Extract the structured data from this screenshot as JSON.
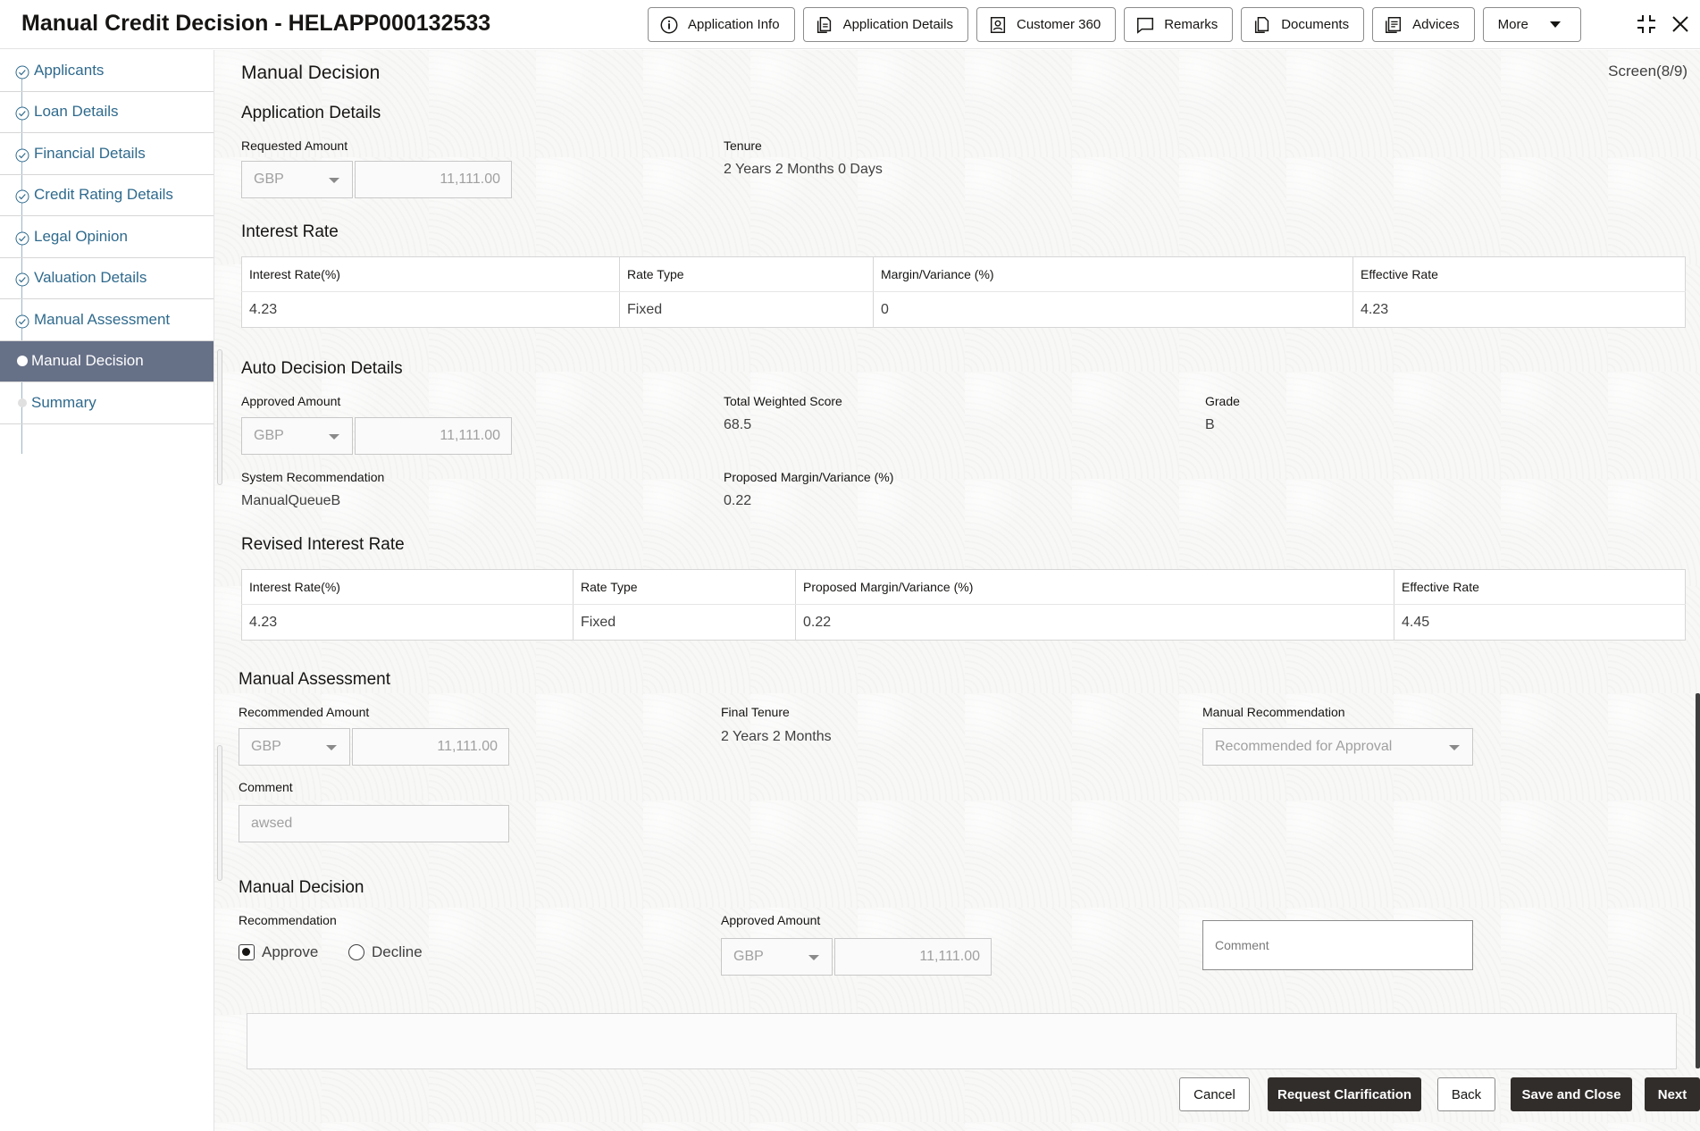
{
  "header": {
    "title": "Manual Credit Decision - HELAPP000132533",
    "buttons": {
      "app_info": "Application Info",
      "app_details": "Application Details",
      "customer360": "Customer 360",
      "remarks": "Remarks",
      "documents": "Documents",
      "advices": "Advices",
      "more": "More"
    }
  },
  "sidebar": {
    "items": [
      {
        "label": "Applicants",
        "status": "done"
      },
      {
        "label": "Loan Details",
        "status": "done"
      },
      {
        "label": "Financial Details",
        "status": "done"
      },
      {
        "label": "Credit Rating Details",
        "status": "done"
      },
      {
        "label": "Legal Opinion",
        "status": "done"
      },
      {
        "label": "Valuation Details",
        "status": "done"
      },
      {
        "label": "Manual Assessment",
        "status": "done"
      },
      {
        "label": "Manual Decision",
        "status": "active"
      },
      {
        "label": "Summary",
        "status": "pending"
      }
    ]
  },
  "main": {
    "page_title": "Manual Decision",
    "screen_indicator": "Screen(8/9)",
    "application_details": {
      "title": "Application Details",
      "requested_amount_label": "Requested Amount",
      "currency": "GBP",
      "requested_amount": "11,111.00",
      "tenure_label": "Tenure",
      "tenure": "2 Years 2 Months 0 Days"
    },
    "interest_rate": {
      "title": "Interest Rate",
      "headers": [
        "Interest Rate(%)",
        "Rate Type",
        "Margin/Variance (%)",
        "Effective Rate"
      ],
      "row": [
        "4.23",
        "Fixed",
        "0",
        "4.23"
      ]
    },
    "auto_decision": {
      "title": "Auto Decision Details",
      "approved_amount_label": "Approved Amount",
      "currency": "GBP",
      "approved_amount": "11,111.00",
      "total_weighted_score_label": "Total Weighted Score",
      "total_weighted_score": "68.5",
      "grade_label": "Grade",
      "grade": "B",
      "system_recommendation_label": "System Recommendation",
      "system_recommendation": "ManualQueueB",
      "proposed_margin_label": "Proposed Margin/Variance (%)",
      "proposed_margin": "0.22"
    },
    "revised_interest_rate": {
      "title": "Revised Interest Rate",
      "headers": [
        "Interest Rate(%)",
        "Rate Type",
        "Proposed Margin/Variance (%)",
        "Effective Rate"
      ],
      "row": [
        "4.23",
        "Fixed",
        "0.22",
        "4.45"
      ]
    },
    "manual_assessment": {
      "title": "Manual Assessment",
      "recommended_amount_label": "Recommended Amount",
      "currency": "GBP",
      "recommended_amount": "11,111.00",
      "final_tenure_label": "Final Tenure",
      "final_tenure": "2 Years 2 Months",
      "manual_recommendation_label": "Manual Recommendation",
      "manual_recommendation": "Recommended for Approval",
      "comment_label": "Comment",
      "comment": "awsed"
    },
    "manual_decision": {
      "title": "Manual Decision",
      "recommendation_label": "Recommendation",
      "approve_label": "Approve",
      "decline_label": "Decline",
      "selected": "Approve",
      "approved_amount_label": "Approved Amount",
      "currency": "GBP",
      "approved_amount": "11,111.00",
      "comment_placeholder": "Comment"
    }
  },
  "footer": {
    "cancel": "Cancel",
    "request_clarification": "Request Clarification",
    "back": "Back",
    "save_and_close": "Save and Close",
    "next": "Next"
  }
}
